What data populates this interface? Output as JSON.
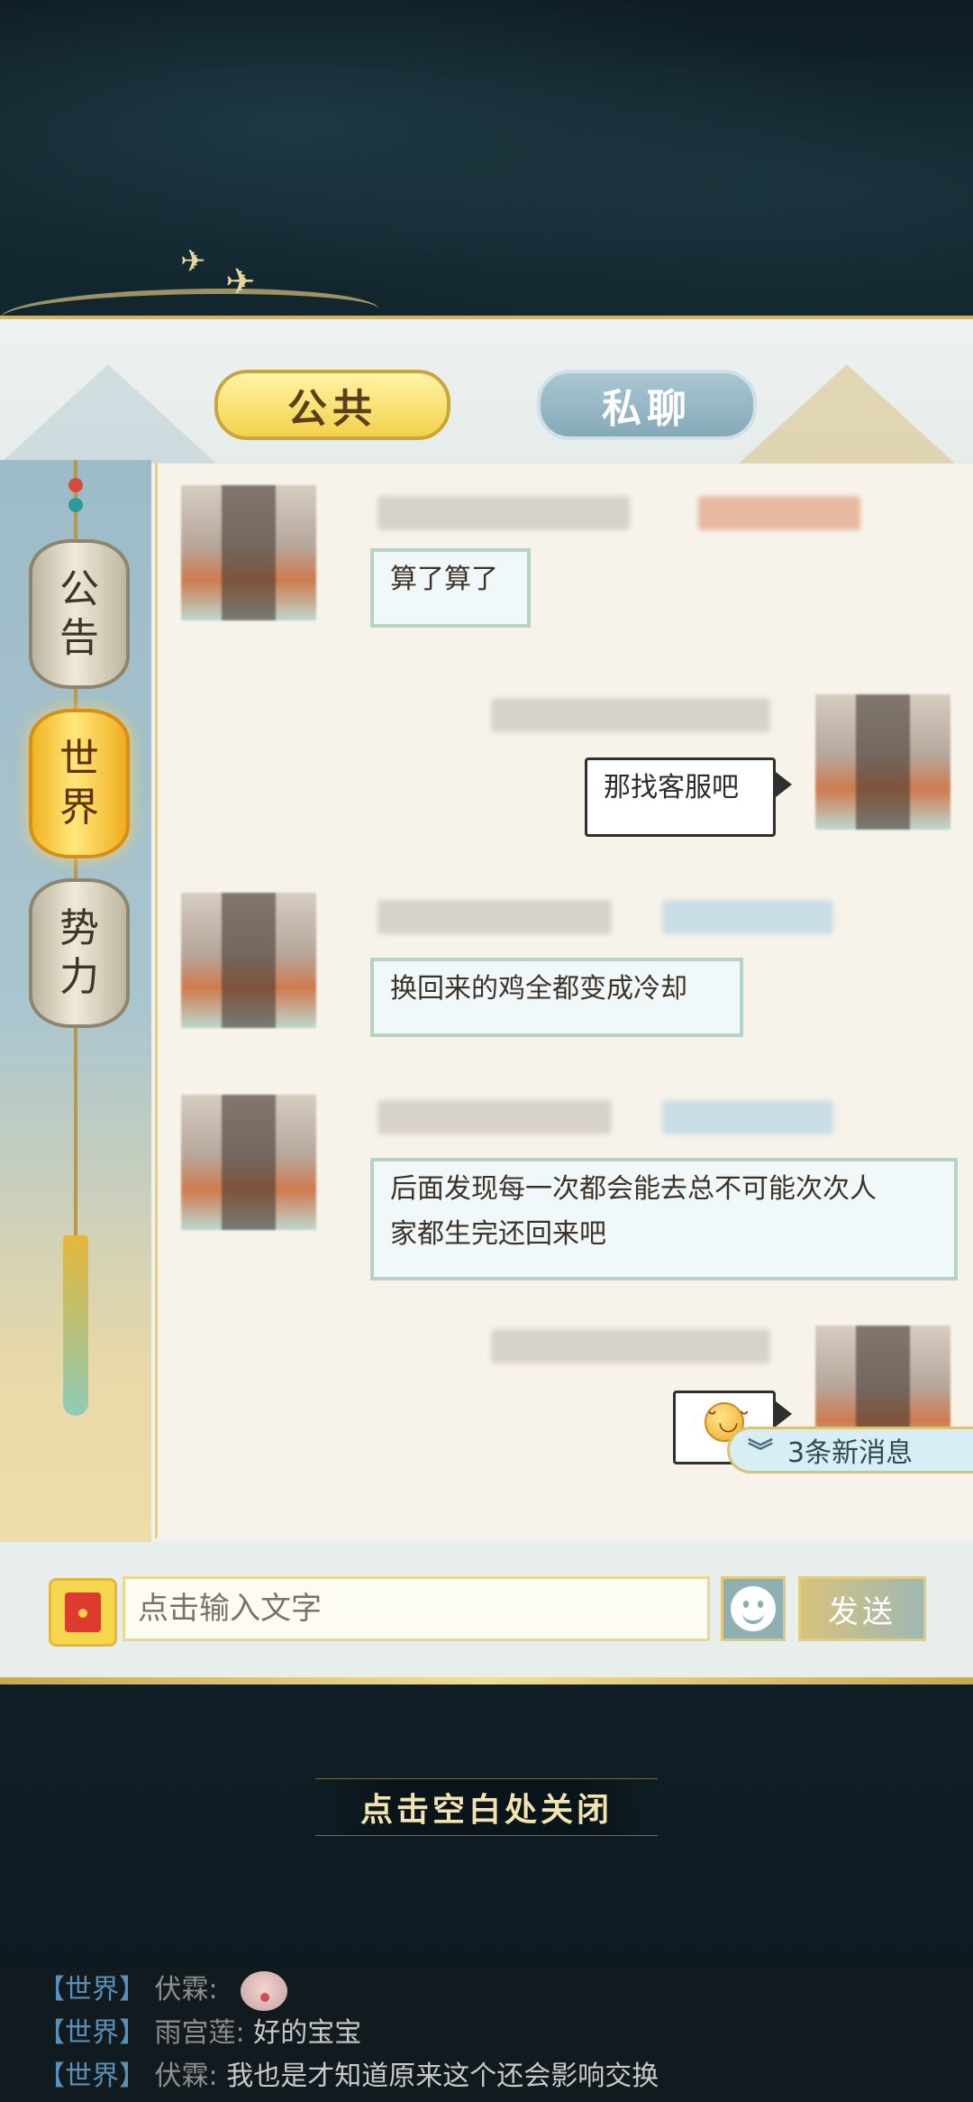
{
  "tabs": {
    "public_label": "公共",
    "private_label": "私聊"
  },
  "channels": [
    {
      "label_line1": "公",
      "label_line2": "告",
      "active": false
    },
    {
      "label_line1": "世",
      "label_line2": "界",
      "active": true
    },
    {
      "label_line1": "势",
      "label_line2": "力",
      "active": false
    }
  ],
  "messages": [
    {
      "side": "left",
      "text": "算了算了"
    },
    {
      "side": "right",
      "text": "那找客服吧"
    },
    {
      "side": "left",
      "text": "换回来的鸡全都变成冷却"
    },
    {
      "side": "left",
      "text_line1": "后面发现每一次都会能去总不可能次次人",
      "text_line2": "家都生完还回来吧"
    },
    {
      "side": "right",
      "emoji": "smile-emoji",
      "glyph": "˘◡˘"
    }
  ],
  "new_messages": {
    "count": "3",
    "label": "条新消息"
  },
  "input": {
    "placeholder": "点击输入文字",
    "send_label": "发送"
  },
  "close_hint": "点击空白处关闭",
  "feed": [
    {
      "channel": "【世界】",
      "name": "伏霖:",
      "text": ""
    },
    {
      "channel": "【世界】",
      "name": "雨宫莲:",
      "text": "好的宝宝"
    },
    {
      "channel": "【世界】",
      "name": "伏霖:",
      "text": "我也是才知道原来这个还会影响交换"
    }
  ],
  "colors": {
    "tab_active": "#f3d24a",
    "tab_inactive": "#86a9b8",
    "lantern_active": "#ffe77a",
    "feed_channel": "#5a8fb8"
  }
}
